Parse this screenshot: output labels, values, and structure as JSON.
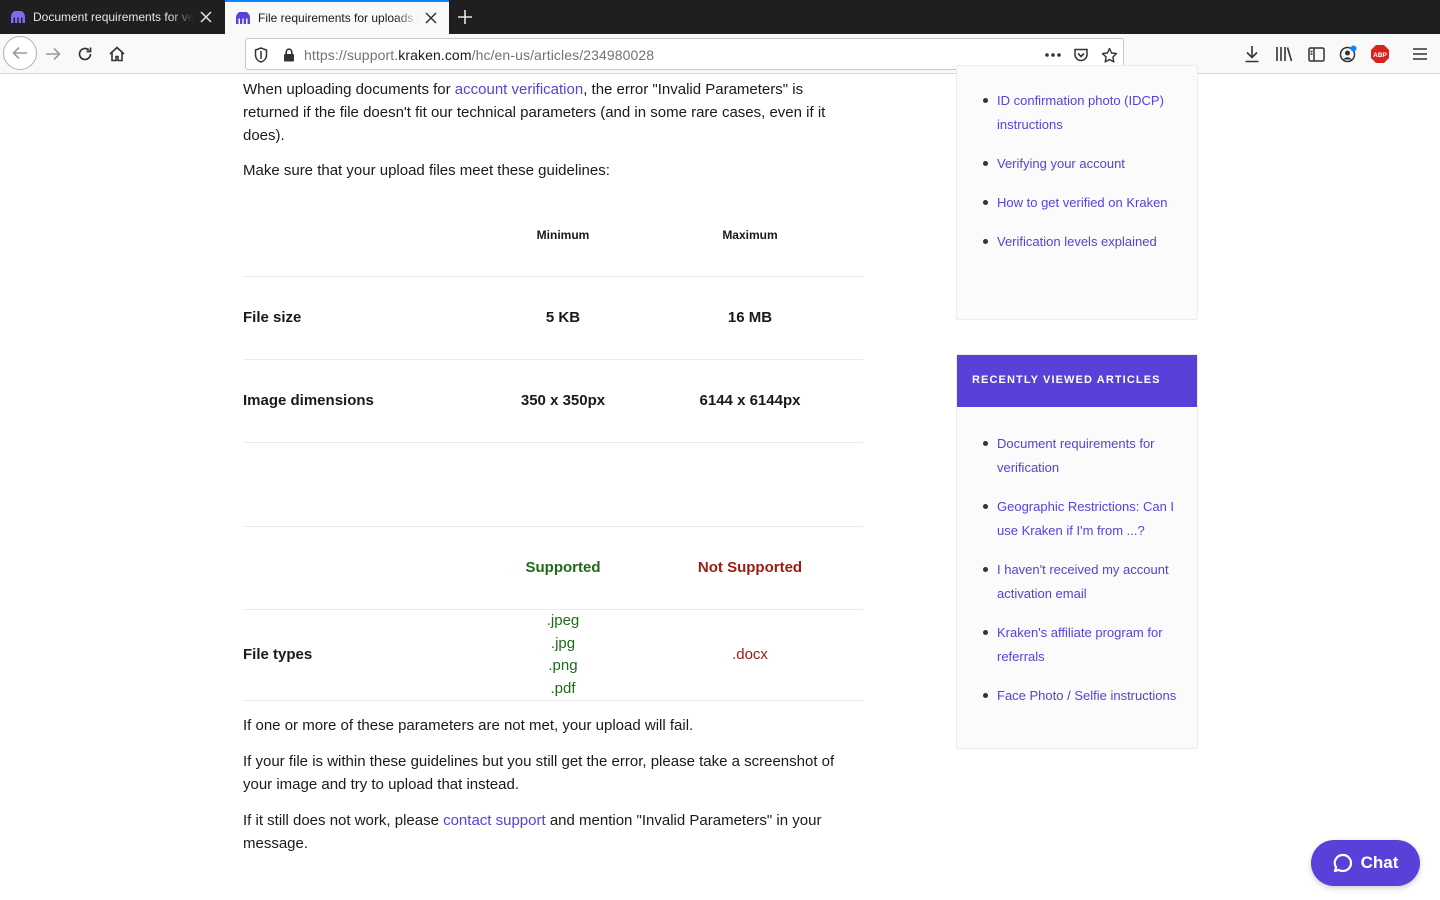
{
  "browser": {
    "tabs": [
      {
        "title": "Document requirements for verification"
      },
      {
        "title": "File requirements for uploads (\"Invalid Parameters\")"
      }
    ],
    "url_prefix": "https://support.",
    "url_domain": "kraken.com",
    "url_path": "/hc/en-us/articles/234980028",
    "addon_badge": "ABP",
    "accent_color": "#5741d9"
  },
  "article": {
    "intro_before": "When uploading documents for ",
    "intro_link": "account verification",
    "intro_after": ", the error \"Invalid Parameters\" is returned if the file doesn't fit our technical parameters (and in some rare cases, even if it does).",
    "guidelines": "Make sure that your upload files meet these guidelines:",
    "table1": {
      "headers": [
        "Minimum",
        "Maximum"
      ],
      "rows": [
        {
          "label": "File size",
          "min": "5 KB",
          "max": "16 MB"
        },
        {
          "label": "Image dimensions",
          "min": "350 x 350px",
          "max": "6144 x 6144px"
        }
      ]
    },
    "table2": {
      "headers": [
        "Supported",
        "Not Supported"
      ],
      "row_label": "File types",
      "supported": [
        ".jpeg",
        ".jpg",
        ".png",
        ".pdf"
      ],
      "not_supported": ".docx"
    },
    "fail_text": "If one or more of these parameters are not met, your upload will fail.",
    "screenshot_text": "If your file is within these guidelines but you still get the error, please take a screenshot of your image and try to upload that instead.",
    "contact_before": "If it still does not work, please ",
    "contact_link": "contact support",
    "contact_after": " and mention \"Invalid Parameters\" in your message."
  },
  "sidebar": {
    "related": [
      "ID confirmation photo (IDCP) instructions",
      "Verifying your account",
      "How to get verified on Kraken",
      "Verification levels explained"
    ],
    "recent_title": "RECENTLY VIEWED ARTICLES",
    "recent": [
      "Document requirements for verification",
      "Geographic Restrictions: Can I use Kraken if I'm from ...?",
      "I haven't received my account activation email",
      "Kraken's affiliate program for referrals",
      "Face Photo / Selfie instructions"
    ]
  },
  "chat": {
    "label": "Chat"
  }
}
